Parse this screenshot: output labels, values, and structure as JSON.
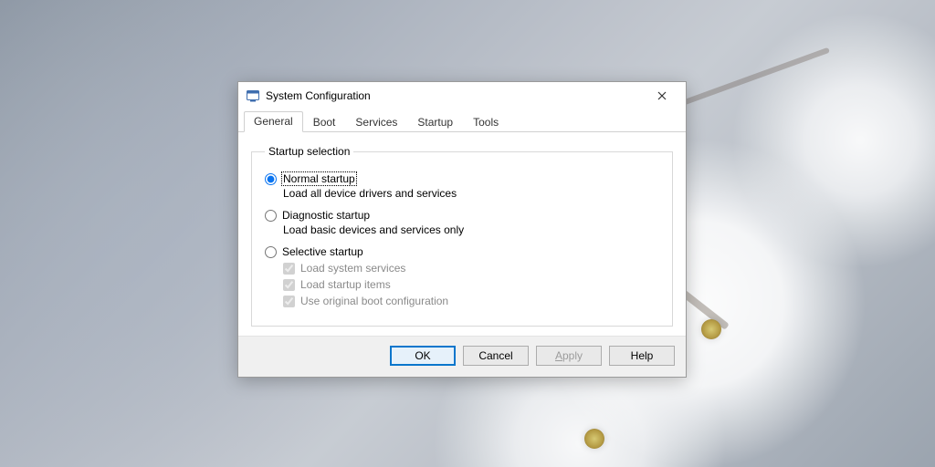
{
  "window": {
    "title": "System Configuration"
  },
  "tabs": [
    {
      "label": "General"
    },
    {
      "label": "Boot"
    },
    {
      "label": "Services"
    },
    {
      "label": "Startup"
    },
    {
      "label": "Tools"
    }
  ],
  "group": {
    "legend": "Startup selection",
    "options": {
      "normal": {
        "label": "Normal startup",
        "desc": "Load all device drivers and services"
      },
      "diagnostic": {
        "label": "Diagnostic startup",
        "desc": "Load basic devices and services only"
      },
      "selective": {
        "label": "Selective startup"
      }
    },
    "subs": {
      "system": {
        "label": "Load system services"
      },
      "startup": {
        "label": "Load startup items"
      },
      "bootcfg": {
        "label": "Use original boot configuration"
      }
    }
  },
  "buttons": {
    "ok": "OK",
    "cancel": "Cancel",
    "apply_prefix": "A",
    "apply_rest": "pply",
    "help": "Help"
  }
}
